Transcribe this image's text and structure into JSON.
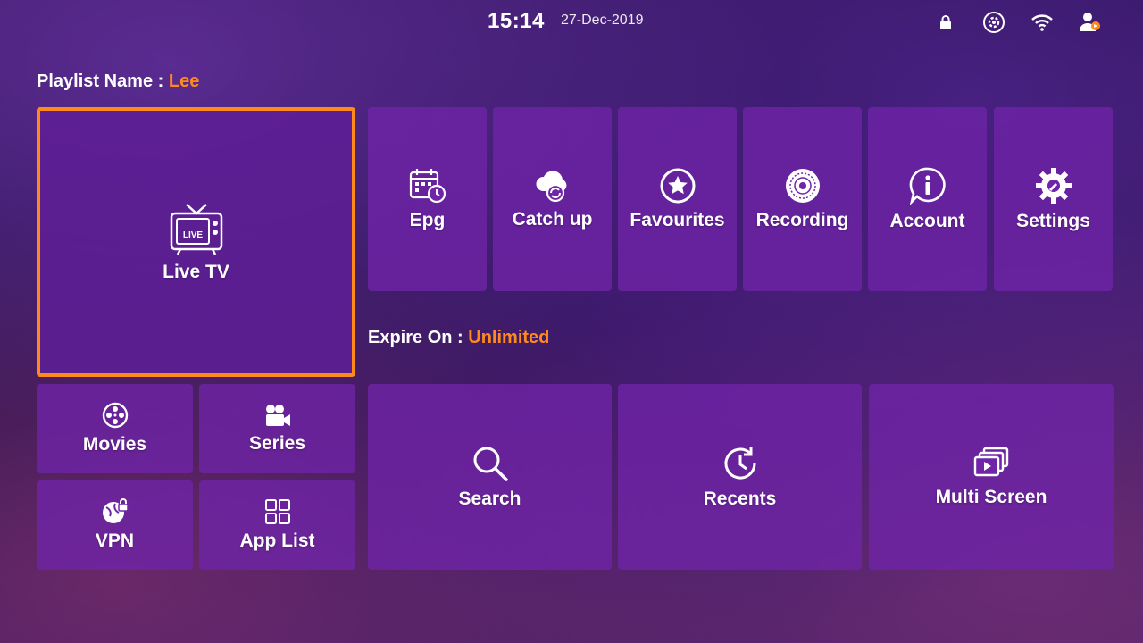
{
  "status_bar": {
    "time": "15:14",
    "date": "27-Dec-2019",
    "icons": [
      "lock-icon",
      "settings-circle-icon",
      "wifi-icon",
      "user-switch-icon"
    ]
  },
  "playlist": {
    "label": "Playlist Name :",
    "value": "Lee"
  },
  "expire": {
    "label": "Expire On :",
    "value": "Unlimited"
  },
  "tiles": {
    "live_tv": {
      "label": "Live TV",
      "icon": "live-tv-icon",
      "focused": true
    },
    "epg": {
      "label": "Epg",
      "icon": "epg-calendar-icon"
    },
    "catch_up": {
      "label": "Catch up",
      "icon": "cloud-sync-icon"
    },
    "favourites": {
      "label": "Favourites",
      "icon": "star-icon"
    },
    "recording": {
      "label": "Recording",
      "icon": "disc-icon"
    },
    "account": {
      "label": "Account",
      "icon": "info-icon"
    },
    "settings": {
      "label": "Settings",
      "icon": "gear-icon"
    },
    "movies": {
      "label": "Movies",
      "icon": "film-reel-icon"
    },
    "series": {
      "label": "Series",
      "icon": "video-camera-icon"
    },
    "vpn": {
      "label": "VPN",
      "icon": "vpn-globe-icon"
    },
    "app_list": {
      "label": "App List",
      "icon": "grid-icon"
    },
    "search": {
      "label": "Search",
      "icon": "search-icon"
    },
    "recents": {
      "label": "Recents",
      "icon": "clock-icon"
    },
    "multi_screen": {
      "label": "Multi Screen",
      "icon": "multi-screen-icon"
    }
  },
  "colors": {
    "accent": "#ff8a1c",
    "tile": "#7024a8",
    "background": "#2e1552"
  }
}
